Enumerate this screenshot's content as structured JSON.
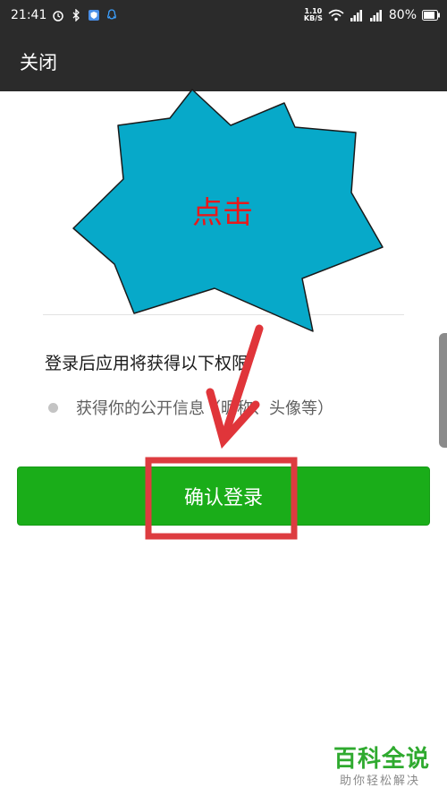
{
  "status_bar": {
    "time": "21:41",
    "net_speed_value": "1.10",
    "net_speed_unit": "KB/S",
    "battery": "80%",
    "icons": [
      "alarm-icon",
      "bluetooth-icon",
      "shield-icon",
      "qq-icon",
      "wifi-icon",
      "signal-icon",
      "battery-icon"
    ]
  },
  "title_bar": {
    "close_label": "关闭"
  },
  "permissions": {
    "title": "登录后应用将获得以下权限",
    "items": [
      {
        "label": "获得你的公开信息（昵称、头像等）"
      }
    ]
  },
  "actions": {
    "confirm_label": "确认登录"
  },
  "annotation": {
    "burst_label": "点击",
    "colors": {
      "burst": "#07a9c9",
      "arrow": "#e0353a",
      "highlight_box": "#dd3c40"
    }
  },
  "watermark": {
    "title": "百科全说",
    "subtitle": "助你轻松解决"
  }
}
